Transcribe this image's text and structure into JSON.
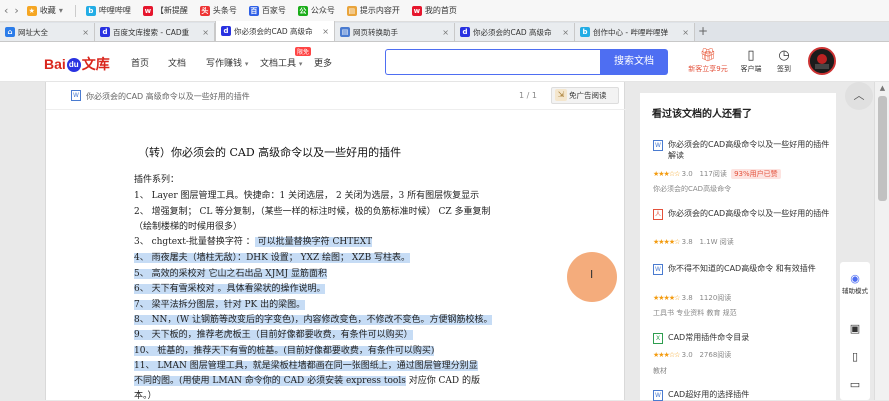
{
  "bookmarks": {
    "items": [
      {
        "label": "收藏",
        "icon": "star-icon",
        "color": "#f5a623"
      },
      {
        "label": "哔哩哔哩",
        "icon": "bilibili-icon",
        "color": "#23ade5"
      },
      {
        "label": "【新提醒",
        "icon": "weibo-icon",
        "color": "#e6162d"
      },
      {
        "label": "头条号",
        "icon": "toutiao-icon",
        "color": "#e33"
      },
      {
        "label": "百家号",
        "icon": "baijiahao-icon",
        "color": "#2e5fe6"
      },
      {
        "label": "公众号",
        "icon": "wechat-icon",
        "color": "#1aad19"
      },
      {
        "label": "提示内容开",
        "icon": "folder-icon",
        "color": "#e9a43b"
      },
      {
        "label": "我的首页",
        "icon": "weibo-icon",
        "color": "#e6162d"
      }
    ]
  },
  "tabs": [
    {
      "label": "网址大全",
      "icon": "home-icon",
      "color": "#2b7ce9"
    },
    {
      "label": "百度文库搜索 - CAD重",
      "icon": "baidu-icon",
      "color": "#2932e1"
    },
    {
      "label": "你必须会的CAD 高级命",
      "icon": "baidu-icon",
      "color": "#2932e1",
      "active": true
    },
    {
      "label": "网页转换助手",
      "icon": "page-icon",
      "color": "#4a7bd0"
    },
    {
      "label": "你必须会的CAD 高级命",
      "icon": "baidu-icon",
      "color": "#2932e1"
    },
    {
      "label": "创作中心 - 哔哩哔哩弹",
      "icon": "bilibili-icon",
      "color": "#23ade5"
    }
  ],
  "header": {
    "logo_text": "Bai",
    "logo_du": "du",
    "logo_wk": "文库",
    "nav": [
      "首页",
      "文档",
      "写作赚钱",
      "文档工具",
      "更多"
    ],
    "new_badge": "限免",
    "search_button": "搜索文档",
    "search_placeholder": "",
    "vip_label": "新客立享9元",
    "client_label": "客户端",
    "signin_label": "签到"
  },
  "doc": {
    "tab_title": "你必须会的CAD 高级命令以及一些好用的插件",
    "page_indicator": "1 / 1",
    "ad_free": "免广告阅读",
    "title": "（转）你必须会的 CAD 高级命令以及一些好用的插件",
    "lines": [
      {
        "text": "插件系列：",
        "hl": ""
      },
      {
        "text": "1、 Layer 图层管理工具。快捷命：1 关闭选层， 2 关闭为选层，3 所有图层恢复显示",
        "hl": ""
      },
      {
        "text": "2、 增强复制； CL 等分复制，（某些一样的标注时候，极的负筋标准时候） CZ 多重复制",
        "hl": ""
      },
      {
        "text": "（绘制楼梯的时候用很多）",
        "hl": ""
      },
      {
        "text": "3、 chgtext-批量替换字符 ：",
        "hl": " 可以批量替换字符 CHTEXT"
      },
      {
        "text": "",
        "hl": "4、 雨夜屠夫（墙柱无敌）：DHK 设置； YXZ 绘图； XZB 写柱表。"
      },
      {
        "text": "",
        "hl": "5、 高效的采校对 它山之石出品 XJMJ 显筋面积"
      },
      {
        "text": "",
        "hl": "6、 天下有雪采校对 。具体看梁状的操作说明。"
      },
      {
        "text": "",
        "hl": "7、 梁平法拆分图层，针对 PK 出的梁图。"
      },
      {
        "text": "",
        "hl": "8、 NN，(W 让钢筋等改变后的字变色)，内容修改变色，不修改不变色。方便钢筋校核。"
      },
      {
        "text": "",
        "hl": "9、 天下板的，推荐老虎板王（目前好像都要收费，有条件可以购买）"
      },
      {
        "text": "",
        "hl": "10、 桩基的，推荐天下有雪的桩基。(目前好像都要收费，有条件可以购买)"
      },
      {
        "text": "",
        "hl": "11、 LMAN 图层管理工具，就是梁板柱墙都画在同一张图纸上，通过图层管理分别显"
      },
      {
        "text": "",
        "hl": "不同的图。(用使用 LMAN 命令你的 CAD 必须安装 express tools",
        "tail": " 对应你 CAD 的版"
      },
      {
        "text": "本。）",
        "hl": ""
      }
    ]
  },
  "sidebar": {
    "title": "看过该文档的人还看了",
    "items": [
      {
        "title": "你必须会的CAD高级命令以及一些好用的插件解读",
        "icon": "W",
        "iconcolor": "#4a7bd0",
        "rating": "3.0",
        "views": "117阅读",
        "badge": "93%用户已赞",
        "source": "你必须会的CAD高级命令"
      },
      {
        "title": "你必须会的CAD高级命令以及一些好用的插件",
        "icon": "人",
        "iconcolor": "#e3513b",
        "rating": "3.8",
        "views": "1.1W 阅读",
        "badge": "",
        "source": ""
      },
      {
        "title": "你不得不知道的CAD高级命令 和有效插件",
        "icon": "W",
        "iconcolor": "#4a7bd0",
        "rating": "3.8",
        "views": "1120阅读",
        "badge": "",
        "source": "工具书 专业资料 教育 规范"
      },
      {
        "title": "CAD常用插件命令目录",
        "icon": "X",
        "iconcolor": "#2e9e4f",
        "rating": "3.0",
        "views": "2768阅读",
        "badge": "",
        "source": "教材"
      },
      {
        "title": "CAD超好用的选择插件",
        "icon": "W",
        "iconcolor": "#4a7bd0",
        "rating": "",
        "views": "",
        "badge": "",
        "source": ""
      }
    ]
  },
  "rightbar": {
    "items": [
      {
        "label": "辅助模式",
        "icon": "assist-mode-icon"
      },
      {
        "label": "",
        "icon": "briefcase-icon"
      },
      {
        "label": "",
        "icon": "phone-icon"
      },
      {
        "label": "",
        "icon": "chat-icon"
      }
    ]
  },
  "colors": {
    "accent": "#4e6ef2",
    "brand_red": "#d9261c",
    "highlight": "#c6dcf5"
  }
}
